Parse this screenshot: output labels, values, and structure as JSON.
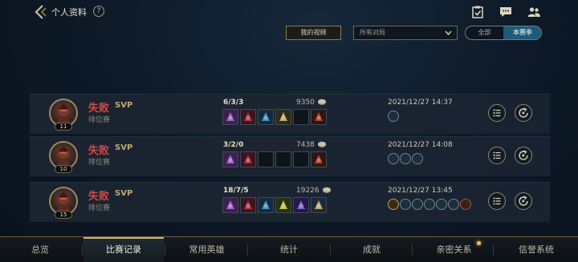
{
  "header": {
    "title": "个人资料",
    "help_label": "?",
    "icons": [
      "task-icon",
      "chat-icon",
      "friends-icon"
    ]
  },
  "filters": {
    "my_videos_label": "我的视频",
    "match_select_value": "所有对局",
    "segment_all_label": "全部",
    "segment_season_label": "本赛季",
    "selected_segment": "本赛季"
  },
  "matches": [
    {
      "level": "11",
      "result": "失败",
      "badge": "SVP",
      "mode": "排位赛",
      "kda": "6/3/3",
      "gold": "9350",
      "datetime": "2021/12/27 14:37",
      "items": [
        "purple-armor",
        "dagger",
        "spear",
        "gold-blade",
        "empty",
        "red-boots"
      ],
      "badges": [
        "blue"
      ]
    },
    {
      "level": "10",
      "result": "失败",
      "badge": "SVP",
      "mode": "排位赛",
      "kda": "3/2/0",
      "gold": "7438",
      "datetime": "2021/12/27 14:08",
      "items": [
        "purple-armor",
        "dagger",
        "empty",
        "empty",
        "empty",
        "red-boots"
      ],
      "badges": [
        "blue",
        "blue",
        "blue"
      ]
    },
    {
      "level": "15",
      "result": "失败",
      "badge": "SVP",
      "mode": "排位赛",
      "kda": "18/7/5",
      "gold": "19226",
      "datetime": "2021/12/27 13:45",
      "items": [
        "purple-armor",
        "dagger",
        "spear",
        "green-triangle",
        "purple-orb",
        "blue-crown"
      ],
      "badges": [
        "gold",
        "blue",
        "blue",
        "blue",
        "blue",
        "blue",
        "copper"
      ]
    }
  ],
  "nav": {
    "items": [
      "总览",
      "比赛记录",
      "常用英雄",
      "统计",
      "成就",
      "亲密关系",
      "信誉系统"
    ],
    "active": "比赛记录"
  },
  "colors": {
    "loss": "#d8463d",
    "accent_gold": "#cdb06a",
    "segment_active": "#1e5a7a"
  }
}
